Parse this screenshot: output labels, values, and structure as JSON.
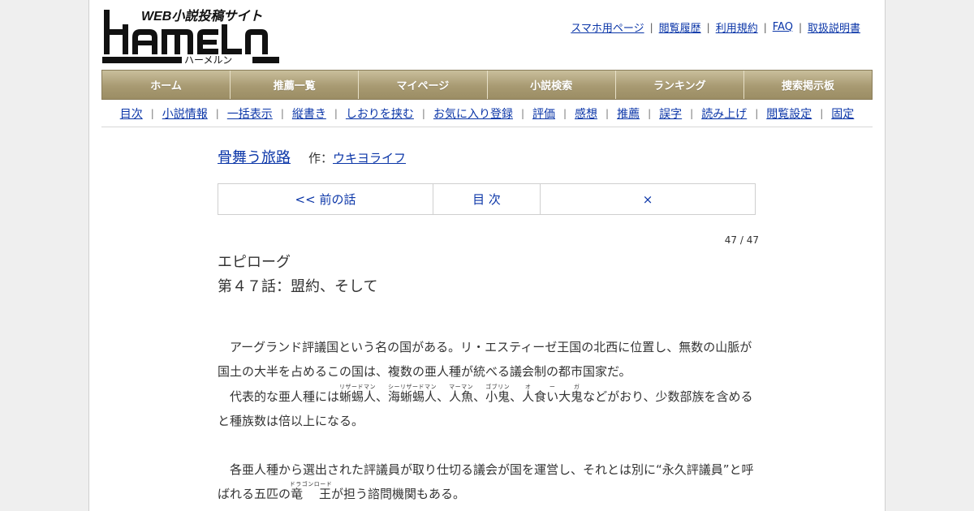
{
  "site": {
    "logo_text": "HAMELN",
    "logo_tagline": "WEB小説投稿サイト",
    "logo_kana": "ハーメルン"
  },
  "toplinks": [
    {
      "label": "スマホ用ページ"
    },
    {
      "label": "閲覧履歴"
    },
    {
      "label": "利用規約"
    },
    {
      "label": "FAQ"
    },
    {
      "label": "取扱説明書"
    }
  ],
  "mainnav": [
    {
      "label": "ホーム"
    },
    {
      "label": "推薦一覧"
    },
    {
      "label": "マイページ"
    },
    {
      "label": "小説検索"
    },
    {
      "label": "ランキング"
    },
    {
      "label": "捜索掲示板"
    }
  ],
  "subnav": [
    {
      "label": "目次"
    },
    {
      "label": "小説情報"
    },
    {
      "label": "一括表示"
    },
    {
      "label": "縦書き"
    },
    {
      "label": "しおりを挟む"
    },
    {
      "label": "お気に入り登録"
    },
    {
      "label": "評価"
    },
    {
      "label": "感想"
    },
    {
      "label": "推薦"
    },
    {
      "label": "誤字"
    },
    {
      "label": "読み上げ"
    },
    {
      "label": "閲覧設定"
    },
    {
      "label": "固定"
    }
  ],
  "novel": {
    "title": "骨舞う旅路",
    "author_label": "作：",
    "author": "ウキヨライフ"
  },
  "pager": {
    "prev": "<< 前の話",
    "toc": "目 次",
    "close": "×"
  },
  "page_count": "47 / 47",
  "chapter": {
    "part": "エピローグ",
    "title": "第４７話：盟約、そして"
  },
  "body": {
    "p1": "　アーグランド評議国という名の国がある。リ・エスティーゼ王国の北西に位置し、無数の山脈が国土の大半を占めるこの国は、複数の亜人種が統べる議会制の都市国家だ。",
    "p2_a": "　代表的な亜人種には",
    "r1_base": "蜥蜴人",
    "r1_rt": "リザードマン",
    "p2_b": "、",
    "r2_base": "海蜥蜴人",
    "r2_rt": "シーリザードマン",
    "p2_c": "、",
    "r3_base": "人魚",
    "r3_rt": "マーマン",
    "p2_d": "、",
    "r4_base": "小鬼",
    "r4_rt": "ゴブリン",
    "p2_e": "、",
    "r5_base": "人食い大鬼",
    "r5_rt": "オ　ー　ガ",
    "p2_f": "などがおり、少数部族を含めると種族数は倍以上になる。",
    "p3_a": "　各亜人種から選出された評議員が取り仕切る議会が国を運営し、それとは別に“永久評議員”と呼ばれる五匹の",
    "r6_base": "竜　王",
    "r6_rt": "ドラゴンロード",
    "p3_b": "が担う諮問機関もある。"
  }
}
